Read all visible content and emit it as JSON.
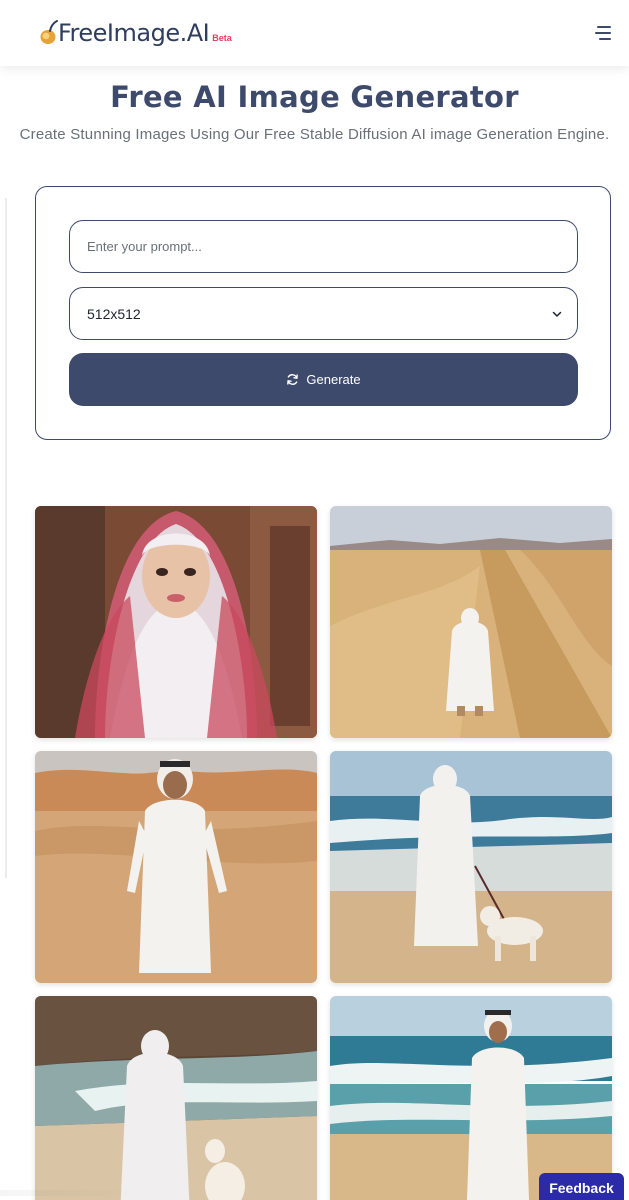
{
  "header": {
    "logo_text": "FreeImage.AI",
    "logo_badge": "Beta",
    "menu_icon": "hamburger-icon",
    "colors": {
      "brand_text": "#2f3d5e",
      "badge": "#e0405f",
      "logo_mark": "#e8a23a"
    }
  },
  "hero": {
    "title": "Free AI Image Generator",
    "subtitle": "Create Stunning Images Using Our Free Stable Diffusion AI image Generation Engine."
  },
  "form": {
    "prompt_placeholder": "Enter your prompt...",
    "prompt_value": "",
    "size_selected": "512x512",
    "generate_label": "Generate",
    "generate_icon": "refresh-icon",
    "accent_color": "#3d4a6b"
  },
  "gallery": {
    "images": [
      {
        "subject": "woman in red patterned headscarf"
      },
      {
        "subject": "man in white thobe walking in desert"
      },
      {
        "subject": "man in white thobe in sand dunes"
      },
      {
        "subject": "woman in white walking dog on beach"
      },
      {
        "subject": "woman in white with dog on beach near cliff"
      },
      {
        "subject": "man in white thobe on beach"
      }
    ]
  },
  "feedback": {
    "label": "Feedback",
    "color": "#2b2aa8"
  }
}
